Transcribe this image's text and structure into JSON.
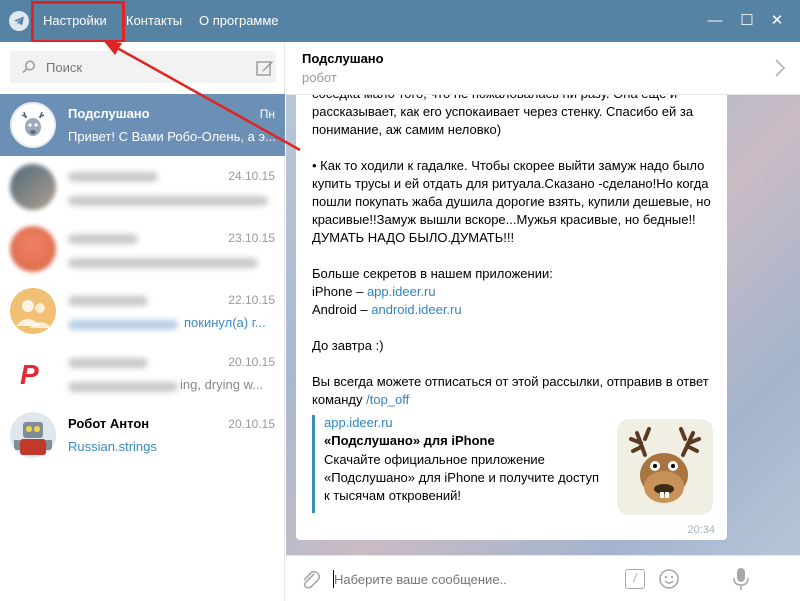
{
  "menu": {
    "settings": "Настройки",
    "contacts": "Контакты",
    "about": "О программе"
  },
  "window_controls": {
    "minimize": "—",
    "maximize": "☐",
    "close": "✕"
  },
  "search": {
    "placeholder": "Поиск"
  },
  "dialogs": [
    {
      "name": "Подслушано",
      "time": "Пн",
      "message": "Привет! С Вами Робо-Олень, а э..."
    },
    {
      "name": "",
      "time": "24.10.15",
      "message": ""
    },
    {
      "name": "",
      "time": "23.10.15",
      "message": ""
    },
    {
      "name": "",
      "time": "22.10.15",
      "message": "покинул(а) г..."
    },
    {
      "name": "",
      "time": "20.10.15",
      "message": "ing, drying w..."
    },
    {
      "name": "Робот Антон",
      "time": "20.10.15",
      "message": "Russian.strings"
    }
  ],
  "chat": {
    "peer_name": "Подслушано",
    "peer_status": "робот",
    "message": {
      "p1": "соседка мало того, что не пожаловалась ни разу. Она еще и рассказывает, как его успокаивает через стенку. Спасибо ей за понимание, аж самим неловко)",
      "p2": "• Как то ходили к гадалке. Чтобы скорее выйти замуж надо было купить трусы и ей отдать для ритуала.Сказано -сделано!Но когда пошли покупать жаба душила дорогие взять, купили дешевые, но красивые!!Замуж вышли вскоре...Мужья красивые, но бедные!! ДУМАТЬ НАДО БЫЛО.ДУМАТЬ!!!",
      "p3": "Больше секретов в нашем приложении:",
      "iphone_label": "iPhone – ",
      "iphone_link": "app.ideer.ru",
      "android_label": "Android – ",
      "android_link": "android.ideer.ru",
      "p4": "До завтра :)",
      "p5": "Вы всегда можете отписаться от этой рассылки, отправив в ответ команду ",
      "command": "/top_off",
      "time": "20:34"
    },
    "preview": {
      "site": "app.ideer.ru",
      "title": "«Подслушано» для iPhone",
      "description": "Скачайте официальное приложение «Подслушано» для iPhone и получите доступ к тысячам откровений!"
    },
    "compose_placeholder": "Наберите ваше сообщение.."
  },
  "colors": {
    "titlebar": "#5682a3",
    "active_dialog": "#6b8fb5",
    "link": "#2f86c1",
    "highlight": "#e02424"
  }
}
